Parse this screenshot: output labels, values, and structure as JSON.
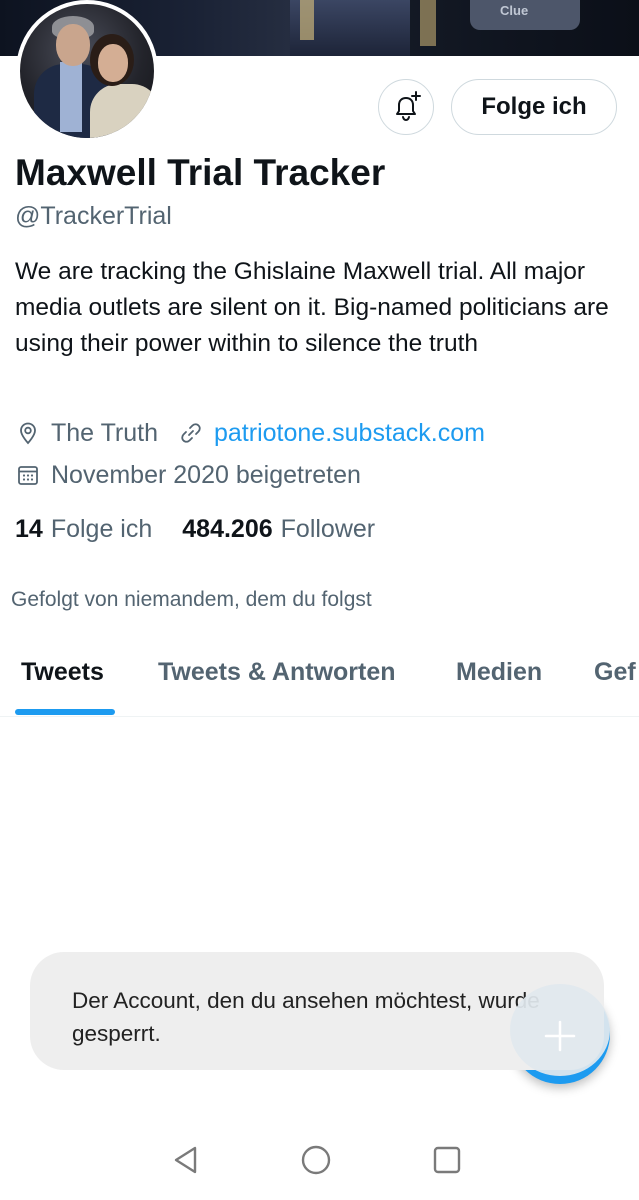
{
  "profile": {
    "name": "Maxwell Trial Tracker",
    "handle": "@TrackerTrial",
    "bio": "We are tracking the Ghislaine Maxwell trial. All major media outlets are silent on it. Big-named politicians are using their power within to silence the truth",
    "location": "The Truth",
    "website": "patriotone.substack.com",
    "joined": "November 2020 beigetreten",
    "following_count": "14",
    "following_label": "Folge ich",
    "followers_count": "484.206",
    "followers_label": "Follower",
    "followed_by_text": "Gefolgt von niemandem, dem du folgst"
  },
  "banner": {
    "sign_text": "Clue"
  },
  "actions": {
    "follow_label": "Folge ich",
    "notification_icon": "bell-plus-icon"
  },
  "tabs": [
    {
      "label": "Tweets",
      "active": true
    },
    {
      "label": "Tweets & Antworten",
      "active": false
    },
    {
      "label": "Medien",
      "active": false
    },
    {
      "label": "Gef",
      "active": false
    }
  ],
  "toast": {
    "message": "Der Account, den du ansehen möchtest, wurde gesperrt."
  },
  "compose": {
    "icon": "plus-icon"
  },
  "system_nav": {
    "back_icon": "back-triangle-icon",
    "home_icon": "home-circle-icon",
    "recents_icon": "recents-square-icon"
  },
  "colors": {
    "accent": "#1d9bf0",
    "primary_text": "#0f1419",
    "secondary_text": "#536471",
    "toast_bg": "#eeeeee"
  }
}
